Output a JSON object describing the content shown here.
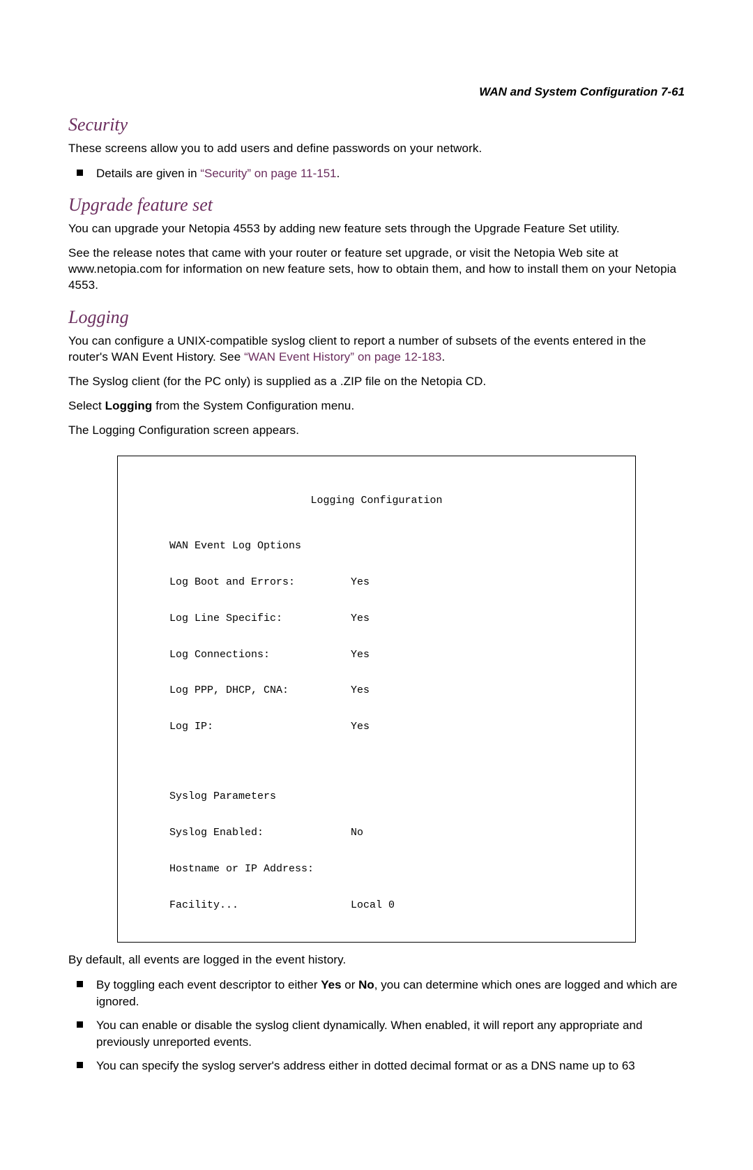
{
  "header": {
    "title": "WAN and System Configuration   7-61"
  },
  "security": {
    "heading": "Security",
    "p1": "These screens allow you to add users and define passwords on your network.",
    "bullet1_prefix": "Details are given in ",
    "bullet1_link": "“Security” on page 11-151",
    "bullet1_suffix": "."
  },
  "upgrade": {
    "heading": "Upgrade feature set",
    "p1": "You can upgrade your Netopia 4553 by adding new feature sets through the Upgrade Feature Set utility.",
    "p2": "See the release notes that came with your router or feature set upgrade, or visit the Netopia Web site at www.netopia.com for information on new feature sets, how to obtain them, and how to install them on your Netopia 4553."
  },
  "logging": {
    "heading": "Logging",
    "p1_prefix": "You can configure a UNIX-compatible syslog client to report a number of subsets of the events entered in the router's WAN Event History. See ",
    "p1_link": "“WAN Event History” on page 12-183",
    "p1_suffix": ".",
    "p2": "The Syslog client (for the PC only) is supplied as a .ZIP file on the Netopia CD.",
    "p3_prefix": "Select ",
    "p3_bold": "Logging",
    "p3_suffix": " from the System Configuration menu.",
    "p4": "The Logging Configuration screen appears.",
    "after_p": "By default, all events are logged in the event history.",
    "bullets": {
      "b1_pre": "By toggling each event descriptor to either ",
      "b1_yes": "Yes",
      "b1_mid": " or ",
      "b1_no": "No",
      "b1_post": ", you can determine which ones are logged and which are ignored.",
      "b2": "You can enable or disable the syslog client dynamically. When enabled, it will report any appropriate and previously unreported events.",
      "b3": "You can specify the syslog server's address either in dotted decimal format or as a DNS name up to 63"
    },
    "terminal": {
      "title": "Logging Configuration",
      "section1": "WAN Event Log Options",
      "rows": [
        {
          "label": "Log Boot and Errors:",
          "value": "Yes"
        },
        {
          "label": "Log Line Specific:",
          "value": "Yes"
        },
        {
          "label": "Log Connections:",
          "value": "Yes"
        },
        {
          "label": "Log PPP, DHCP, CNA:",
          "value": "Yes"
        },
        {
          "label": "Log IP:",
          "value": "Yes"
        }
      ],
      "section2": "Syslog Parameters",
      "rows2": [
        {
          "label": "Syslog Enabled:",
          "value": "No"
        },
        {
          "label": "Hostname or IP Address:",
          "value": ""
        },
        {
          "label": "Facility...",
          "value": "Local 0"
        }
      ]
    }
  }
}
